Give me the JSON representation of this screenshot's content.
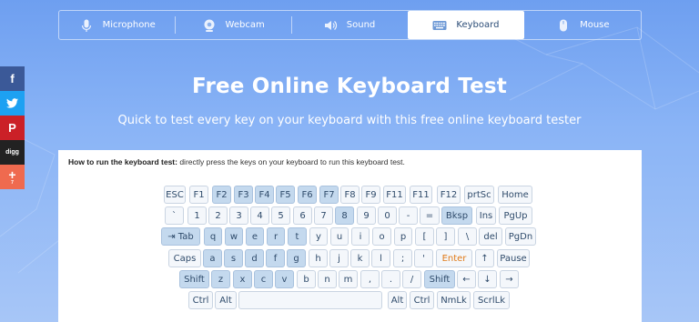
{
  "nav": {
    "items": [
      {
        "label": "Microphone",
        "icon": "microphone-icon",
        "active": false
      },
      {
        "label": "Webcam",
        "icon": "webcam-icon",
        "active": false
      },
      {
        "label": "Sound",
        "icon": "speaker-icon",
        "active": false
      },
      {
        "label": "Keyboard",
        "icon": "keyboard-icon",
        "active": true
      },
      {
        "label": "Mouse",
        "icon": "mouse-icon",
        "active": false
      }
    ]
  },
  "social": {
    "facebook": "f",
    "twitter": "t",
    "pinterest": "P",
    "digg": "digg",
    "more": "+",
    "more_count": "7"
  },
  "hero": {
    "title": "Free Online Keyboard Test",
    "subtitle": "Quick to test every key on your keyboard with this free online keyboard tester"
  },
  "panel": {
    "howto_bold": "How to run the keyboard test:",
    "howto_text": " directly press the keys on your keyboard to run this keyboard test."
  },
  "keyboard": {
    "rows": [
      [
        {
          "label": "ESC",
          "hl": false
        },
        {
          "label": "F1",
          "hl": false
        },
        {
          "label": "F2",
          "hl": true
        },
        {
          "label": "F3",
          "hl": true
        },
        {
          "label": "F4",
          "hl": true
        },
        {
          "label": "F5",
          "hl": true
        },
        {
          "label": "F6",
          "hl": true
        },
        {
          "label": "F7",
          "hl": true
        },
        {
          "label": "F8",
          "hl": false
        },
        {
          "label": "F9",
          "hl": false
        },
        {
          "label": "F11",
          "hl": false
        },
        {
          "label": "F11",
          "hl": false
        },
        {
          "label": "F12",
          "hl": false
        },
        {
          "label": "prtSc",
          "hl": false
        },
        {
          "label": "Home",
          "hl": false
        }
      ],
      [
        {
          "label": "`",
          "hl": false
        },
        {
          "label": "1",
          "hl": false
        },
        {
          "label": "2",
          "hl": false
        },
        {
          "label": "3",
          "hl": false
        },
        {
          "label": "4",
          "hl": false
        },
        {
          "label": "5",
          "hl": false
        },
        {
          "label": "6",
          "hl": false
        },
        {
          "label": "7",
          "hl": false
        },
        {
          "label": "8",
          "hl": true
        },
        {
          "label": "9",
          "hl": false
        },
        {
          "label": "0",
          "hl": false
        },
        {
          "label": "-",
          "hl": false
        },
        {
          "label": "=",
          "hl": false
        },
        {
          "label": "Bksp",
          "hl": true
        },
        {
          "label": "Ins",
          "hl": false
        },
        {
          "label": "PgUp",
          "hl": false
        }
      ],
      [
        {
          "label": "⇥ Tab",
          "hl": true
        },
        {
          "label": "q",
          "hl": true
        },
        {
          "label": "w",
          "hl": true
        },
        {
          "label": "e",
          "hl": true
        },
        {
          "label": "r",
          "hl": true
        },
        {
          "label": "t",
          "hl": true
        },
        {
          "label": "y",
          "hl": false
        },
        {
          "label": "u",
          "hl": false
        },
        {
          "label": "i",
          "hl": false
        },
        {
          "label": "o",
          "hl": false
        },
        {
          "label": "p",
          "hl": false
        },
        {
          "label": "[",
          "hl": false
        },
        {
          "label": "]",
          "hl": false
        },
        {
          "label": "\\",
          "hl": false
        },
        {
          "label": "del",
          "hl": false
        },
        {
          "label": "PgDn",
          "hl": false
        }
      ],
      [
        {
          "label": "Caps",
          "hl": false
        },
        {
          "label": "a",
          "hl": true
        },
        {
          "label": "s",
          "hl": true
        },
        {
          "label": "d",
          "hl": true
        },
        {
          "label": "f",
          "hl": true
        },
        {
          "label": "g",
          "hl": true
        },
        {
          "label": "h",
          "hl": false
        },
        {
          "label": "j",
          "hl": false
        },
        {
          "label": "k",
          "hl": false
        },
        {
          "label": "l",
          "hl": false
        },
        {
          "label": ";",
          "hl": false
        },
        {
          "label": "'",
          "hl": false
        },
        {
          "label": "Enter",
          "hl": false,
          "enter": true
        },
        {
          "label": "↑",
          "hl": false
        },
        {
          "label": "Pause",
          "hl": false
        }
      ],
      [
        {
          "label": "Shift",
          "hl": true
        },
        {
          "label": "z",
          "hl": true
        },
        {
          "label": "x",
          "hl": true
        },
        {
          "label": "c",
          "hl": true
        },
        {
          "label": "v",
          "hl": true
        },
        {
          "label": "b",
          "hl": false
        },
        {
          "label": "n",
          "hl": false
        },
        {
          "label": "m",
          "hl": false
        },
        {
          "label": ",",
          "hl": false
        },
        {
          "label": ".",
          "hl": false
        },
        {
          "label": "/",
          "hl": false
        },
        {
          "label": "Shift",
          "hl": true
        },
        {
          "label": "←",
          "hl": false
        },
        {
          "label": "↓",
          "hl": false
        },
        {
          "label": "→",
          "hl": false
        }
      ],
      [
        {
          "label": "Ctrl",
          "hl": false
        },
        {
          "label": "Alt",
          "hl": false
        },
        {
          "label": "",
          "hl": false
        },
        {
          "label": "Alt",
          "hl": false
        },
        {
          "label": "Ctrl",
          "hl": false
        },
        {
          "label": "NmLk",
          "hl": false
        },
        {
          "label": "ScrlLk",
          "hl": false
        }
      ]
    ]
  }
}
